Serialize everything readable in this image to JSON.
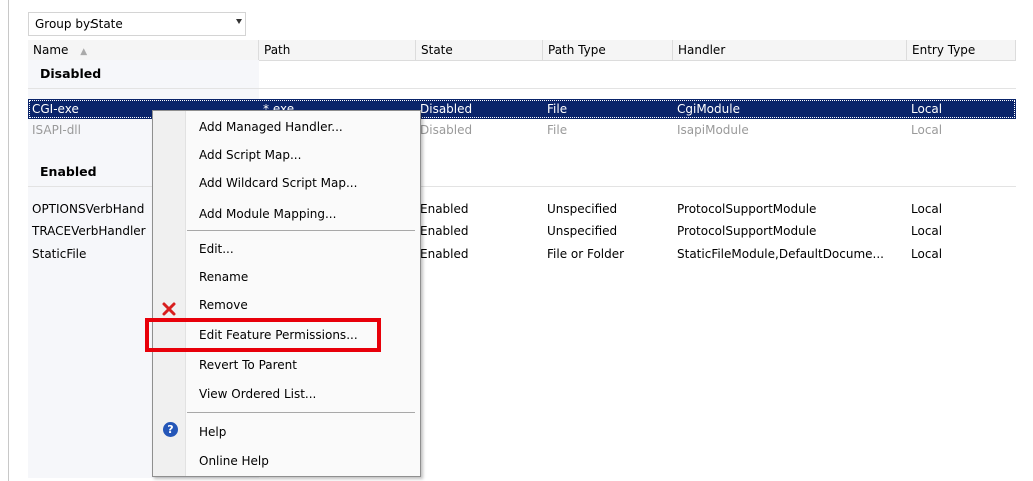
{
  "toolbar": {
    "group_by_label": "Group by:",
    "group_by_value": "State"
  },
  "columns": [
    {
      "label": "Name"
    },
    {
      "label": "Path"
    },
    {
      "label": "State"
    },
    {
      "label": "Path Type"
    },
    {
      "label": "Handler"
    },
    {
      "label": "Entry Type"
    }
  ],
  "groups": {
    "disabled": "Disabled",
    "enabled": "Enabled"
  },
  "rows": [
    {
      "name": "CGI-exe",
      "path": "*.exe",
      "state": "Disabled",
      "path_type": "File",
      "handler": "CgiModule",
      "entry_type": "Local"
    },
    {
      "name": "ISAPI-dll",
      "path": "",
      "state": "Disabled",
      "path_type": "File",
      "handler": "IsapiModule",
      "entry_type": "Local"
    },
    {
      "name": "OPTIONSVerbHand",
      "path": "",
      "state": "Enabled",
      "path_type": "Unspecified",
      "handler": "ProtocolSupportModule",
      "entry_type": "Local"
    },
    {
      "name": "TRACEVerbHandler",
      "path": "",
      "state": "Enabled",
      "path_type": "Unspecified",
      "handler": "ProtocolSupportModule",
      "entry_type": "Local"
    },
    {
      "name": "StaticFile",
      "path": "",
      "state": "Enabled",
      "path_type": "File or Folder",
      "handler": "StaticFileModule,DefaultDocume...",
      "entry_type": "Local"
    }
  ],
  "context_menu": {
    "items": [
      "Add Managed Handler...",
      "Add Script Map...",
      "Add Wildcard Script Map...",
      "Add Module Mapping...",
      "Edit...",
      "Rename",
      "Remove",
      "Edit Feature Permissions...",
      "Revert To Parent",
      "View Ordered List...",
      "Help",
      "Online Help"
    ],
    "highlighted_item": "Edit Feature Permissions...",
    "highlight_color": "#e8000a"
  },
  "colors": {
    "selection": "#0a246a",
    "accent_help": "#2456b8",
    "remove_icon": "#d81e1e"
  },
  "icons": {
    "remove": "red-x-icon",
    "help": "help-icon"
  }
}
